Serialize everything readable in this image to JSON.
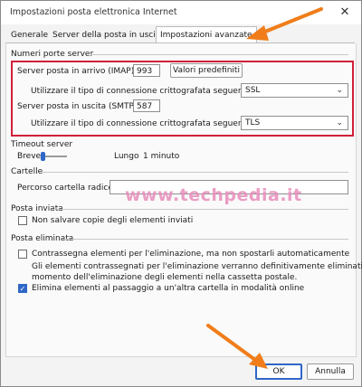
{
  "window": {
    "title": "Impostazioni posta elettronica Internet",
    "close_glyph": "✕"
  },
  "tabs": [
    {
      "label": "Generale"
    },
    {
      "label": "Server della posta in uscita"
    },
    {
      "label": "Impostazioni avanzate"
    }
  ],
  "server_ports": {
    "section_label": "Numeri porte server",
    "imap_label": "Server posta in arrivo (IMAP):",
    "imap_value": "993",
    "defaults_button": "Valori predefiniti",
    "enc_label_1": "Utilizzare il tipo di connessione crittografata seguente:",
    "enc_value_1": "SSL",
    "smtp_label": "Server posta in uscita (SMTP):",
    "smtp_value": "587",
    "enc_label_2": "Utilizzare il tipo di connessione crittografata seguente:",
    "enc_value_2": "TLS"
  },
  "timeout": {
    "section_label": "Timeout server",
    "short_label": "Breve",
    "long_label": "Lungo",
    "value_label": "1 minuto",
    "level": 0.05
  },
  "folders": {
    "section_label": "Cartelle",
    "root_label": "Percorso cartella radice:",
    "root_value": ""
  },
  "sent": {
    "section_label": "Posta inviata",
    "no_copies_label": "Non salvare copie degli elementi inviati",
    "no_copies_checked": false
  },
  "deleted": {
    "section_label": "Posta eliminata",
    "mark_label": "Contrassegna elementi per l'eliminazione, ma non spostarli automaticamente",
    "mark_checked": false,
    "note_line_1": "Gli elementi contrassegnati per l'eliminazione verranno definitivamente eliminati al",
    "note_line_2": "momento dell'eliminazione degli elementi nella cassetta postale.",
    "move_label": "Elimina elementi al passaggio a un'altra cartella in modalità online",
    "move_checked": true
  },
  "watermark": "www.techpedia.it",
  "buttons": {
    "ok": "OK",
    "cancel": "Annulla"
  },
  "colors": {
    "highlight_box": "#d0203a",
    "arrow": "#f07d1a",
    "accent": "#2f66c8"
  },
  "icons": {
    "check": "✓",
    "chevron": "⌄"
  }
}
